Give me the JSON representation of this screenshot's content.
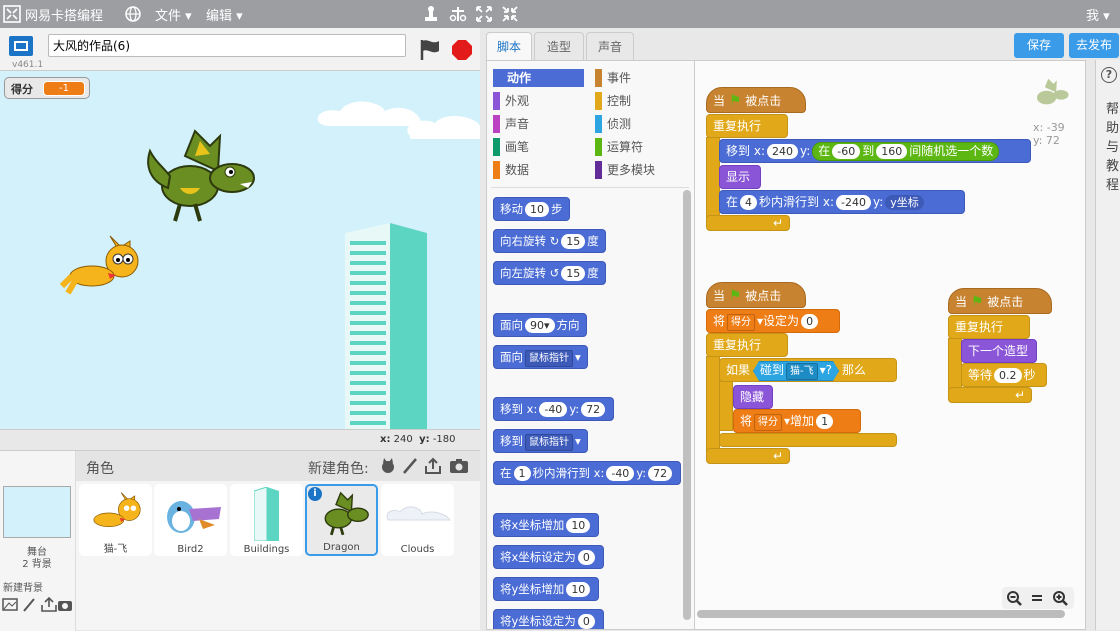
{
  "menubar": {
    "app_name": "网易卡搭编程",
    "file_menu": "文件",
    "edit_menu": "编辑",
    "user_label": "我"
  },
  "stage_header": {
    "project_title": "大风的作品(6)",
    "version": "v461.1"
  },
  "variable_monitor": {
    "name": "得分",
    "value": "-1"
  },
  "stage_coords": {
    "x_label": "x:",
    "x_value": "240",
    "y_label": "y:",
    "y_value": "-180"
  },
  "sprites": {
    "header_label": "角色",
    "new_sprite_label": "新建角色:",
    "backdrop": {
      "title": "舞台",
      "count": "2 背景",
      "new_backdrop_label": "新建背景"
    },
    "items": [
      {
        "name": "猫-飞"
      },
      {
        "name": "Bird2"
      },
      {
        "name": "Buildings"
      },
      {
        "name": "Dragon"
      },
      {
        "name": "Clouds"
      }
    ],
    "selected": "Dragon"
  },
  "tabs": [
    {
      "label": "脚本"
    },
    {
      "label": "造型"
    },
    {
      "label": "声音"
    }
  ],
  "actions": {
    "save": "保存",
    "publish": "去发布"
  },
  "categories": [
    {
      "label": "动作",
      "color": "#4a6cd4"
    },
    {
      "label": "事件",
      "color": "#c88330"
    },
    {
      "label": "外观",
      "color": "#8a55d7"
    },
    {
      "label": "控制",
      "color": "#e1a91a"
    },
    {
      "label": "声音",
      "color": "#bb42c3"
    },
    {
      "label": "侦测",
      "color": "#2ca5e2"
    },
    {
      "label": "画笔",
      "color": "#0e9a6c"
    },
    {
      "label": "运算符",
      "color": "#5cb712"
    },
    {
      "label": "数据",
      "color": "#ee7d16"
    },
    {
      "label": "更多模块",
      "color": "#632d99"
    }
  ],
  "palette_blocks": {
    "move": {
      "label": "移动",
      "value": "10",
      "suffix": "步"
    },
    "turn_right": {
      "label": "向右旋转",
      "value": "15",
      "suffix": "度"
    },
    "turn_left": {
      "label": "向左旋转",
      "value": "15",
      "suffix": "度"
    },
    "point_dir": {
      "label": "面向",
      "value": "90▾",
      "suffix": "方向"
    },
    "point_towards": {
      "label": "面向",
      "value": "鼠标指针"
    },
    "goto_xy": {
      "label": "移到",
      "x_label": "x:",
      "x": "-40",
      "y_label": "y:",
      "y": "72"
    },
    "goto_target": {
      "label": "移到",
      "value": "鼠标指针"
    },
    "glide": {
      "prefix": "在",
      "secs": "1",
      "mid": "秒内滑行到",
      "x_label": "x:",
      "x": "-40",
      "y_label": "y:",
      "y": "72"
    },
    "change_x": {
      "label": "将x坐标增加",
      "value": "10"
    },
    "set_x": {
      "label": "将x坐标设定为",
      "value": "0"
    },
    "change_y": {
      "label": "将y坐标增加",
      "value": "10"
    },
    "set_y": {
      "label": "将y坐标设定为",
      "value": "0"
    }
  },
  "sprite_info": {
    "x_label": "x:",
    "x": "-39",
    "y_label": "y:",
    "y": "72"
  },
  "scripts": {
    "s1": {
      "hat_when": "当",
      "hat_clicked": "被点击",
      "forever": "重复执行",
      "goto_label": "移到",
      "goto_x_label": "x:",
      "goto_x": "240",
      "goto_y_label": "y:",
      "rand_prefix": "在",
      "rand_from": "-60",
      "rand_to_label": "到",
      "rand_to": "160",
      "rand_suffix": "间随机选一个数",
      "show": "显示",
      "glide_prefix": "在",
      "glide_secs": "4",
      "glide_mid": "秒内滑行到",
      "glide_x_label": "x:",
      "glide_x": "-240",
      "glide_y_label": "y:",
      "glide_y": "y坐标"
    },
    "s2": {
      "hat_when": "当",
      "hat_clicked": "被点击",
      "set_prefix": "将",
      "set_var": "得分",
      "set_mid": "设定为",
      "set_val": "0",
      "forever": "重复执行",
      "if_label": "如果",
      "touching_label": "碰到",
      "touching_target": "猫-飞",
      "touching_q": "?",
      "then_label": "那么",
      "hide": "隐藏",
      "change_prefix": "将",
      "change_var": "得分",
      "change_mid": "增加",
      "change_val": "1"
    },
    "s3": {
      "hat_when": "当",
      "hat_clicked": "被点击",
      "forever": "重复执行",
      "next_costume": "下一个造型",
      "wait_label": "等待",
      "wait_val": "0.2",
      "wait_suffix": "秒"
    }
  },
  "help_text": "帮助与教程"
}
